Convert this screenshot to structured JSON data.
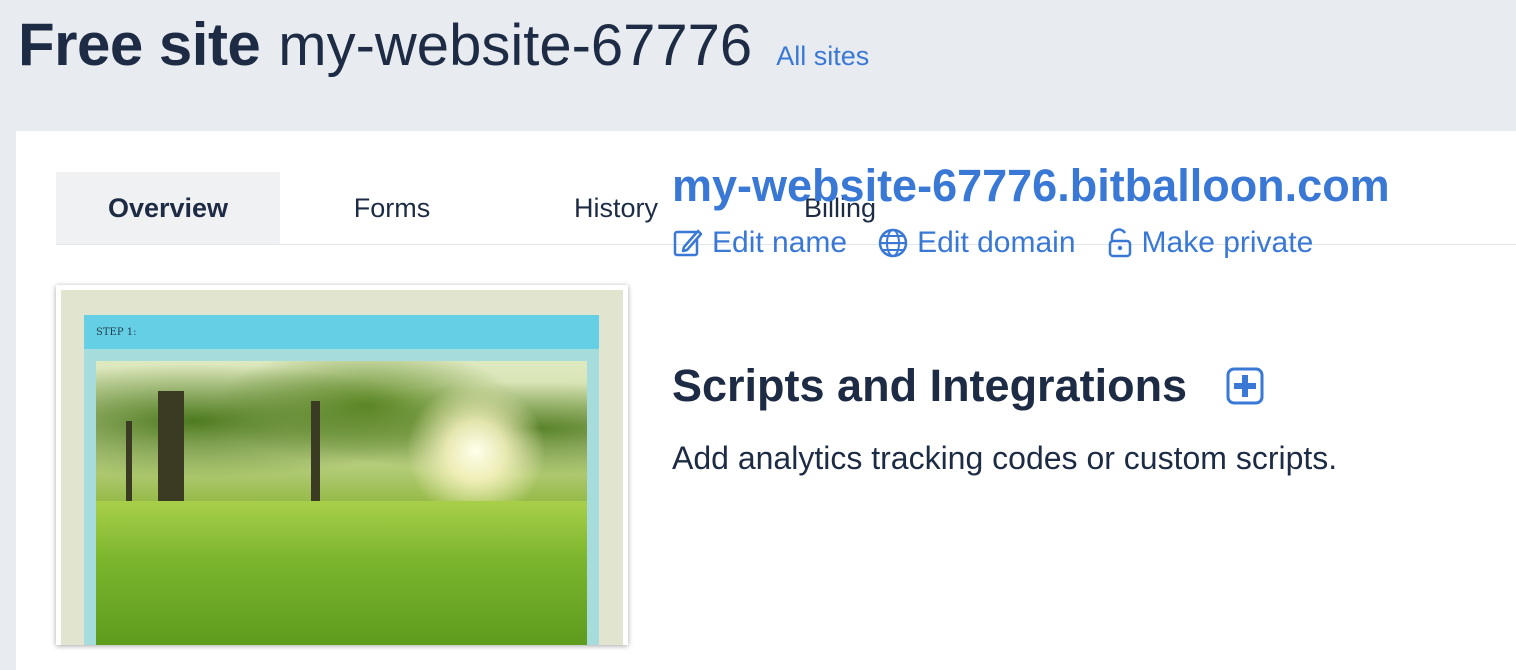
{
  "header": {
    "title_strong": "Free site",
    "site_name": "my-website-67776",
    "all_sites_link": "All sites"
  },
  "tabs": [
    {
      "label": "Overview",
      "active": true
    },
    {
      "label": "Forms",
      "active": false
    },
    {
      "label": "History",
      "active": false
    },
    {
      "label": "Billing",
      "active": false
    }
  ],
  "thumbnail": {
    "step_label": "STEP 1:"
  },
  "site": {
    "domain": "my-website-67776.bitballoon.com",
    "actions": [
      {
        "label": "Edit name",
        "icon": "pencil-icon"
      },
      {
        "label": "Edit domain",
        "icon": "globe-icon"
      },
      {
        "label": "Make private",
        "icon": "unlock-icon"
      }
    ]
  },
  "scripts": {
    "title": "Scripts and Integrations",
    "description": "Add analytics tracking codes or custom scripts."
  },
  "colors": {
    "accent": "#3a78d6",
    "text": "#1d2c44",
    "background": "#e8ebef"
  }
}
